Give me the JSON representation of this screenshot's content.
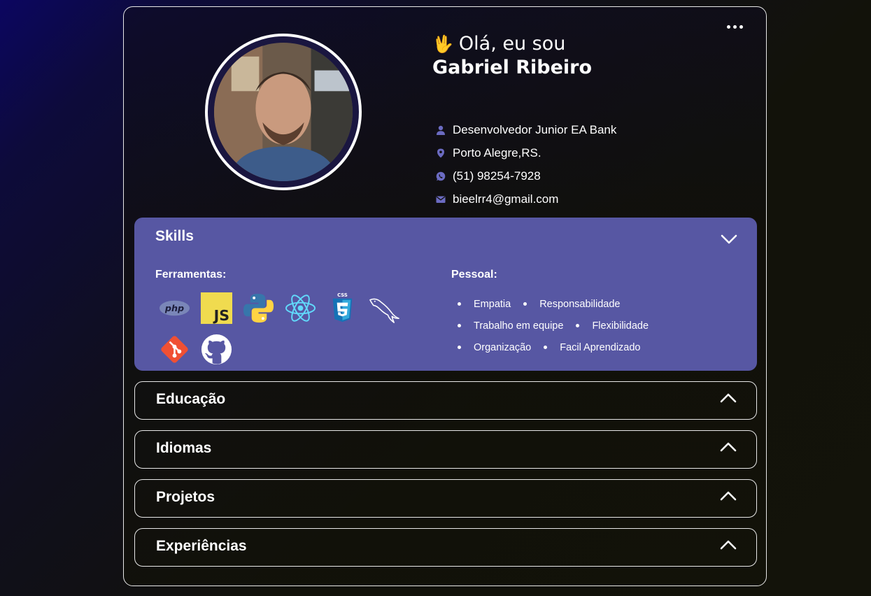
{
  "profile": {
    "greeting_emoji": "🖖",
    "greeting_prefix": "Olá, eu sou",
    "name": "Gabriel Ribeiro",
    "avatar_alt": "profile-photo"
  },
  "contacts": [
    {
      "icon": "user-icon",
      "text": "Desenvolvedor Junior EA Bank"
    },
    {
      "icon": "location-pin-icon",
      "text": "Porto Alegre,RS."
    },
    {
      "icon": "whatsapp-icon",
      "text": "(51) 98254-7928"
    },
    {
      "icon": "mail-icon",
      "text": "bieelrr4@gmail.com"
    }
  ],
  "skills": {
    "title": "Skills",
    "tools_label": "Ferramentas:",
    "personal_label": "Pessoal:",
    "tools": [
      "php-icon",
      "javascript-icon",
      "python-icon",
      "react-icon",
      "css3-icon",
      "mysql-icon",
      "git-icon",
      "github-icon"
    ],
    "personal": [
      [
        "Empatia",
        "Responsabilidade"
      ],
      [
        "Trabalho em equipe",
        "Flexibilidade"
      ],
      [
        "Organização",
        "Facil Aprendizado"
      ]
    ]
  },
  "sections": [
    "Educação",
    "Idiomas",
    "Projetos",
    "Experiências"
  ],
  "colors": {
    "skills_panel": "#5757a3",
    "icon_accent": "#6b6bc2"
  }
}
